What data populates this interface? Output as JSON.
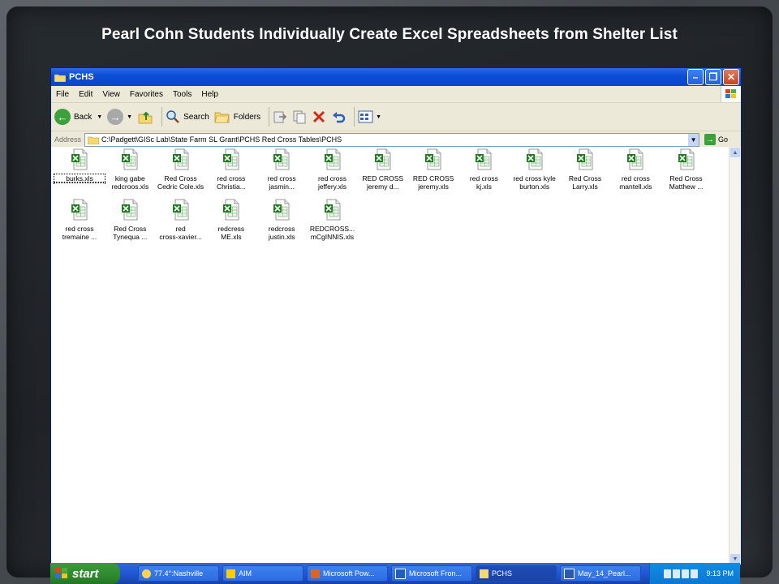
{
  "slide": {
    "title": "Pearl Cohn Students Individually Create Excel Spreadsheets from Shelter List"
  },
  "window": {
    "title": "PCHS",
    "menu": [
      "File",
      "Edit",
      "View",
      "Favorites",
      "Tools",
      "Help"
    ],
    "toolbar": {
      "back_label": "Back",
      "search_label": "Search",
      "folders_label": "Folders"
    },
    "address": {
      "label": "Address",
      "value": "C:\\Padgett\\GISc Lab\\State Farm SL Grant\\PCHS Red Cross Tables\\PCHS",
      "go_label": "Go"
    },
    "files": [
      {
        "line1": "burks.xls",
        "line2": ""
      },
      {
        "line1": "king gabe",
        "line2": "redcroos.xls"
      },
      {
        "line1": "Red Cross",
        "line2": "Cedric Cole.xls"
      },
      {
        "line1": "red cross",
        "line2": "Christia..."
      },
      {
        "line1": "red cross",
        "line2": "jasmin..."
      },
      {
        "line1": "red cross",
        "line2": "jeffery.xls"
      },
      {
        "line1": "RED CROSS",
        "line2": "jeremy d..."
      },
      {
        "line1": "RED CROSS",
        "line2": "jeremy.xls"
      },
      {
        "line1": "red cross",
        "line2": "kj.xls"
      },
      {
        "line1": "red cross kyle",
        "line2": "burton.xls"
      },
      {
        "line1": "Red Cross",
        "line2": "Larry.xls"
      },
      {
        "line1": "red cross",
        "line2": "mantell.xls"
      },
      {
        "line1": "Red Cross",
        "line2": "Matthew ..."
      },
      {
        "line1": "red cross",
        "line2": "tremaine ..."
      },
      {
        "line1": "Red Cross",
        "line2": "Tynequa ..."
      },
      {
        "line1": "red",
        "line2": "cross-xavier..."
      },
      {
        "line1": "redcress",
        "line2": "ME.xls"
      },
      {
        "line1": "redcross",
        "line2": "justin.xls"
      },
      {
        "line1": "REDCROSS...",
        "line2": "mCgINNIS.xls"
      }
    ]
  },
  "taskbar": {
    "start_label": "start",
    "items": [
      {
        "label": "77.4°:Nashville",
        "icon": "weather-icon"
      },
      {
        "label": "AIM",
        "icon": "aim-icon"
      },
      {
        "label": "Microsoft Pow...",
        "icon": "powerpoint-icon"
      },
      {
        "label": "Microsoft Fron...",
        "icon": "frontpage-icon"
      },
      {
        "label": "PCHS",
        "icon": "folder-icon"
      },
      {
        "label": "May_14_Pearl...",
        "icon": "word-icon"
      }
    ],
    "clock": "9:13 PM"
  },
  "colors": {
    "xp_blue": "#0a4fd6",
    "start_green": "#2f8a2f",
    "excel_green": "#1f7a1f"
  }
}
